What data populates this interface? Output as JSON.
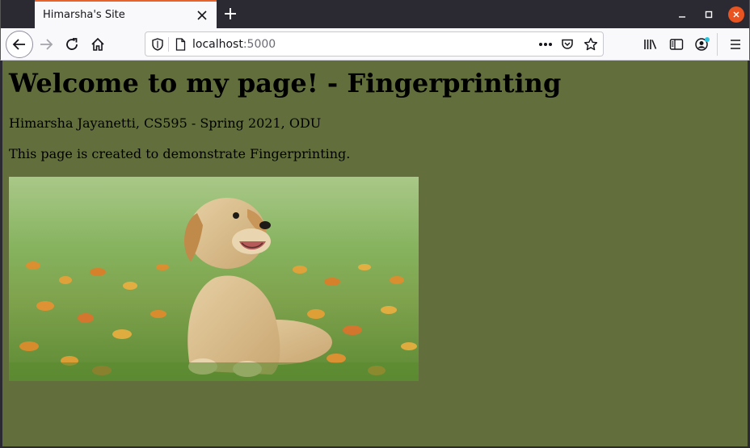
{
  "browser": {
    "tab": {
      "title": "Himarsha's Site"
    },
    "url": {
      "host": "localhost",
      "port": ":5000"
    }
  },
  "page": {
    "heading": "Welcome to my page! - Fingerprinting",
    "author_line": "Himarsha Jayanetti, CS595 - Spring 2021, ODU",
    "description": "This page is created to demonstrate Fingerprinting.",
    "background_color": "#626f3c"
  },
  "colors": {
    "tab_accent": "#e8632b",
    "close_button": "#e95420"
  },
  "icons": [
    "back-icon",
    "forward-icon",
    "reload-icon",
    "home-icon",
    "shield-icon",
    "page-icon",
    "more-icon",
    "pocket-icon",
    "star-icon",
    "library-icon",
    "sidebar-icon",
    "account-icon",
    "menu-icon",
    "close-icon",
    "plus-icon",
    "minimize-icon",
    "maximize-icon"
  ]
}
